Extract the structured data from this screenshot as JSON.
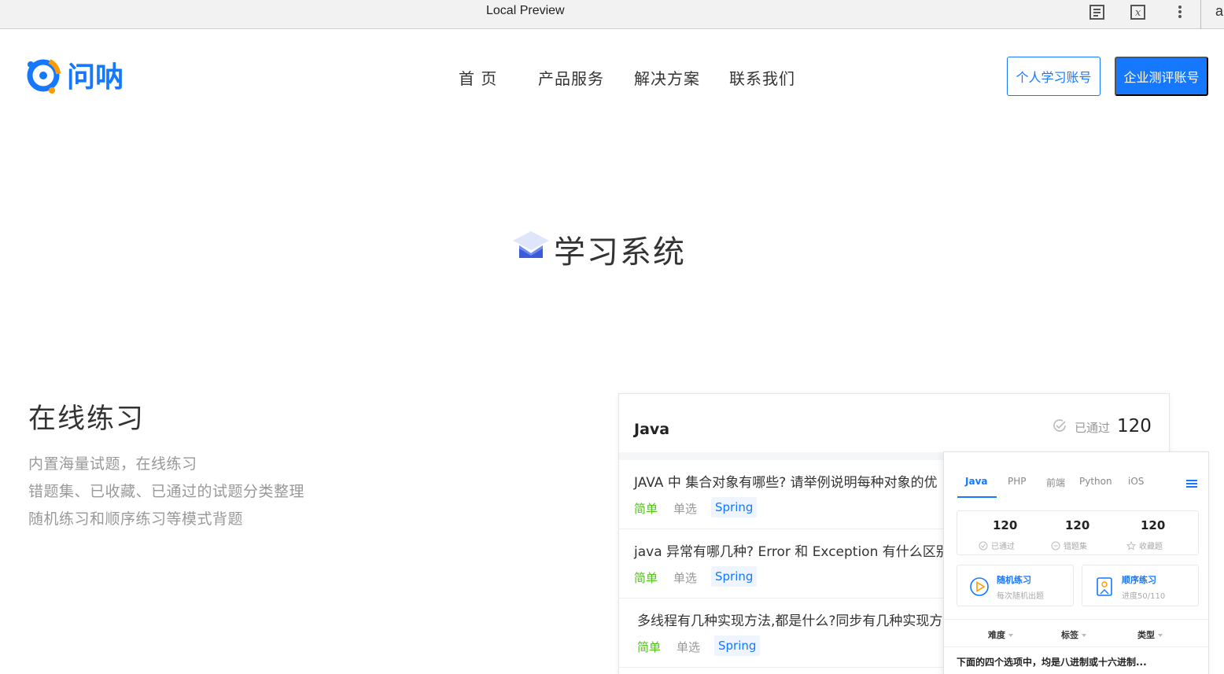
{
  "preview_bar": {
    "title": "Local Preview",
    "icons": [
      "reader-icon",
      "formula-icon",
      "more-vertical-icon"
    ],
    "edge_glyph": "a"
  },
  "header": {
    "logo_text": "问呐",
    "nav": [
      "首 页",
      "产品服务",
      "解决方案",
      "联系我们"
    ],
    "btn_personal": "个人学习账号",
    "btn_enterprise": "企业测评账号"
  },
  "section": {
    "title": "学习系统"
  },
  "feature": {
    "title": "在线练习",
    "lines": [
      "内置海量试题，在线练习",
      "错题集、已收藏、已通过的试题分类整理",
      "随机练习和顺序练习等模式背题"
    ]
  },
  "card": {
    "language": "Java",
    "passed_label": "已通过",
    "passed_count": "120",
    "questions": [
      {
        "text": "JAVA 中 集合对象有哪些? 请举例说明每种对象的优",
        "difficulty": "简单",
        "type": "单选",
        "tag": "Spring"
      },
      {
        "text": "java 异常有哪几种? Error 和 Exception 有什么区别",
        "difficulty": "简单",
        "type": "单选",
        "tag": "Spring"
      },
      {
        "text": "多线程有几种实现方法,都是什么?同步有几种实现方",
        "difficulty": "简单",
        "type": "单选",
        "tag": "Spring"
      }
    ]
  },
  "panel": {
    "tabs": [
      "Java",
      "PHP",
      "前端",
      "Python",
      "iOS"
    ],
    "active_tab": "Java",
    "stats": [
      {
        "value": "120",
        "label": "已通过"
      },
      {
        "value": "120",
        "label": "错题集"
      },
      {
        "value": "120",
        "label": "收藏题"
      }
    ],
    "modes": [
      {
        "title": "随机练习",
        "sub": "每次随机出题"
      },
      {
        "title": "顺序练习",
        "sub": "进度50/110"
      }
    ],
    "filters": [
      "难度",
      "标签",
      "类型"
    ],
    "question_preview": "下面的四个选项中，均是八进制或十六进制..."
  },
  "colors": {
    "accent": "#1677ff",
    "easy": "#52c41a",
    "muted": "#999999"
  }
}
